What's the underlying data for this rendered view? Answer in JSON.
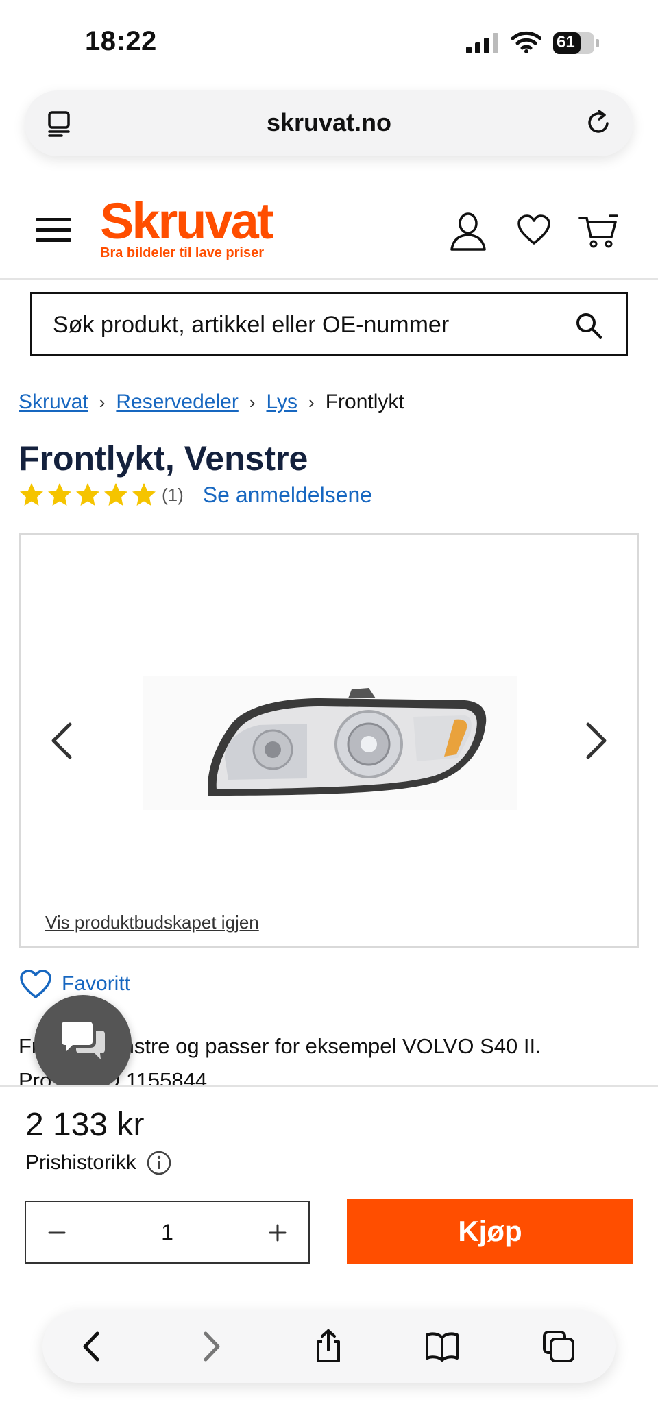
{
  "status_bar": {
    "time": "18:22",
    "battery": "61"
  },
  "browser": {
    "url": "skruvat.no"
  },
  "header": {
    "logo_name": "Skruvat",
    "logo_tagline": "Bra bildeler til lave priser",
    "brand_color": "#ff4e00"
  },
  "search": {
    "placeholder": "Søk produkt, artikkel eller OE-nummer"
  },
  "breadcrumb": {
    "items": [
      "Skruvat",
      "Reservedeler",
      "Lys"
    ],
    "current": "Frontlykt"
  },
  "product": {
    "title": "Frontlykt, Venstre",
    "rating": 5,
    "review_count": "(1)",
    "reviews_link": "Se anmeldelsene",
    "video_link": "Vis produktbudskapet igjen",
    "favorite_label": "Favoritt",
    "description_line1": "Fr        , Venstre og passer for eksempel VOLVO S40 II.",
    "description_line2": "Pro         D 1155844"
  },
  "purchase": {
    "price": "2 133 kr",
    "price_history": "Prishistorikk",
    "quantity": "1",
    "buy_label": "Kjøp"
  },
  "icons": [
    "reader-icon",
    "reload-icon",
    "menu-icon",
    "account-icon",
    "heart-icon",
    "cart-icon",
    "search-icon",
    "star-icon",
    "chevron-left-icon",
    "chevron-right-icon",
    "chat-icon",
    "info-icon",
    "minus-icon",
    "plus-icon",
    "back-icon",
    "forward-icon",
    "share-icon",
    "bookmarks-icon",
    "tabs-icon"
  ],
  "colors": {
    "link": "#1767c0",
    "accent": "#ff4e00",
    "star": "#f5c400",
    "title": "#14213d"
  }
}
